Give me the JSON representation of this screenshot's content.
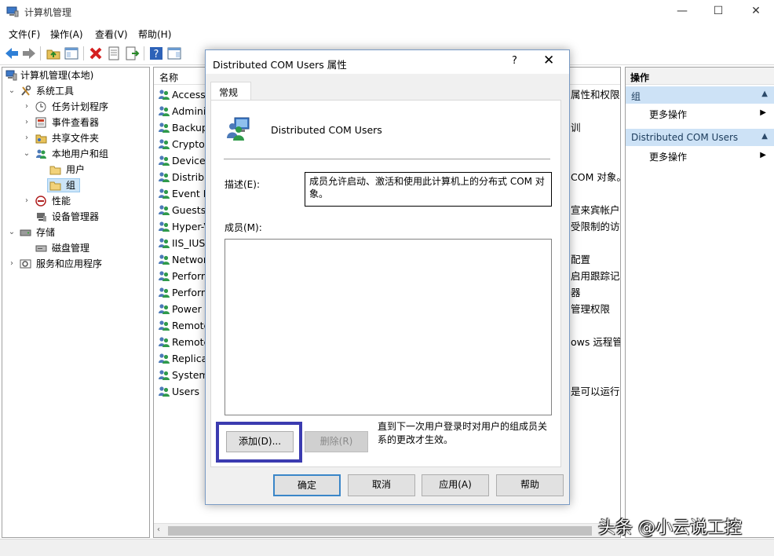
{
  "window": {
    "title": "计算机管理",
    "controls": {
      "minimize": "—",
      "maximize": "☐",
      "close": "✕"
    }
  },
  "menubar": [
    "文件(F)",
    "操作(A)",
    "查看(V)",
    "帮助(H)"
  ],
  "tree": {
    "items": [
      {
        "label": "计算机管理(本地)",
        "icon": "computer-management-icon",
        "twisty": ""
      },
      {
        "label": "系统工具",
        "icon": "tools-icon",
        "twisty": "⌄"
      },
      {
        "label": "任务计划程序",
        "icon": "clock-icon",
        "twisty": "›"
      },
      {
        "label": "事件查看器",
        "icon": "event-viewer-icon",
        "twisty": "›"
      },
      {
        "label": "共享文件夹",
        "icon": "shared-folder-icon",
        "twisty": "›"
      },
      {
        "label": "本地用户和组",
        "icon": "users-icon",
        "twisty": "⌄"
      },
      {
        "label": "用户",
        "icon": "folder-icon",
        "twisty": ""
      },
      {
        "label": "组",
        "icon": "folder-icon",
        "twisty": ""
      },
      {
        "label": "性能",
        "icon": "performance-icon",
        "twisty": "›"
      },
      {
        "label": "设备管理器",
        "icon": "device-manager-icon",
        "twisty": ""
      },
      {
        "label": "存储",
        "icon": "storage-icon",
        "twisty": "⌄"
      },
      {
        "label": "磁盘管理",
        "icon": "disk-icon",
        "twisty": ""
      },
      {
        "label": "服务和应用程序",
        "icon": "services-icon",
        "twisty": "›"
      }
    ]
  },
  "list": {
    "column_name": "名称",
    "rows": [
      {
        "name": "Access",
        "desc": "属性和权限。"
      },
      {
        "name": "Adminis",
        "desc": ""
      },
      {
        "name": "Backup",
        "desc": "训"
      },
      {
        "name": "Cryptog",
        "desc": ""
      },
      {
        "name": "Device",
        "desc": ""
      },
      {
        "name": "Distribu",
        "desc": "COM 对象。"
      },
      {
        "name": "Event Lo",
        "desc": ""
      },
      {
        "name": "Guests",
        "desc": "宣来宾帐户的"
      },
      {
        "name": "Hyper-V",
        "desc": "受限制的访"
      },
      {
        "name": "IIS_IUSR",
        "desc": ""
      },
      {
        "name": "Networ",
        "desc": "配置"
      },
      {
        "name": "Perform",
        "desc": "启用跟踪记"
      },
      {
        "name": "Perform",
        "desc": "器"
      },
      {
        "name": "Power U",
        "desc": "管理权限"
      },
      {
        "name": "Remote",
        "desc": ""
      },
      {
        "name": "Remote",
        "desc": "ows 远程管理"
      },
      {
        "name": "Replicat",
        "desc": ""
      },
      {
        "name": "System",
        "desc": ""
      },
      {
        "name": "Users",
        "desc": "是可以运行大"
      }
    ]
  },
  "actions": {
    "title": "操作",
    "sections": [
      {
        "label": "组",
        "arrow": "▲",
        "item": "更多操作",
        "item_arrow": "▶"
      },
      {
        "label": "Distributed COM Users",
        "arrow": "▲",
        "item": "更多操作",
        "item_arrow": "▶"
      }
    ]
  },
  "dialog": {
    "title": "Distributed COM Users 属性",
    "help_glyph": "?",
    "close_glyph": "✕",
    "tab": "常规",
    "group_name": "Distributed COM Users",
    "desc_label": "描述(E):",
    "desc_value": "成员允许启动、激活和使用此计算机上的分布式 COM 对象。",
    "members_label": "成员(M):",
    "add_button": "添加(D)...",
    "remove_button": "删除(R)",
    "note": "直到下一次用户登录时对用户的组成员关系的更改才生效。",
    "ok": "确定",
    "cancel": "取消",
    "apply": "应用(A)",
    "help": "帮助"
  },
  "watermark": "头条 @小云说工控",
  "colors": {
    "accent": "#3a86c8",
    "highlight_box": "#3b3bb0",
    "action_section": "#cde2f6"
  }
}
